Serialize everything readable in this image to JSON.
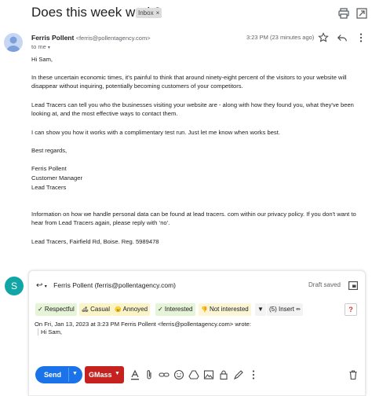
{
  "email": {
    "subject": "Does this week work?",
    "label_chip": "Inbox",
    "label_chip_close": "×",
    "sender_name": "Ferris Pollent",
    "sender_email": "<ferris@pollentagency.com>",
    "date": "3:23 PM (23 minutes ago)",
    "to_line": "to me",
    "paragraphs": [
      "Hi Sam,",
      "In these uncertain economic times, it's painful to think that around ninety-eight percent of the visitors to your website will disappear without inquiring, potentially becoming customers of your competitors.",
      "Lead Tracers can tell you who the businesses visiting your website are - along with how they found you, what they've been looking at, and the most effective ways to contact them.",
      "I can show you how it works with a complimentary test run. Just let me know when works best.",
      "Best regards,",
      "Ferris Pollent",
      "Customer Manager",
      "Lead Tracers",
      "Information on how we handle personal data can be found at lead tracers. com within our privacy policy. If you don't want to hear from Lead Tracers again, please reply with ‘no’.",
      "Lead Tracers, Fairfield Rd, Boise.  Reg. 5989478"
    ]
  },
  "reply": {
    "avatar_letter": "S",
    "to": "Ferris Pollent (ferris@pollentagency.com)",
    "status": "Draft saved",
    "chips": {
      "respectful": "✓ Respectful",
      "casual": "Casual",
      "annoyed": "Annoyed",
      "interested": "✓ Interested",
      "not_interested": "Not interested",
      "filter": "▼",
      "insert": "(5) Insert",
      "help": "?"
    },
    "quote_header": "On Fri, Jan 13, 2023 at 3:23 PM Ferris Pollent <ferris@pollentagency.com> wrote:",
    "quote_first_line": "Hi Sam,",
    "send_label": "Send",
    "gmass_label": "GMass"
  },
  "colors": {
    "send": "#1a73e8",
    "gmass": "#c5221f",
    "reply_avatar": "#12a5a5"
  }
}
